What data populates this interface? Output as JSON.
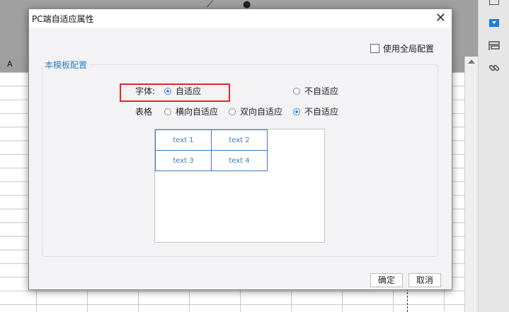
{
  "spreadsheet": {
    "column_a": "A"
  },
  "dialog": {
    "title": "PC端自适应属性",
    "close_glyph": "✕",
    "global_config_label": "使用全局配置",
    "section_title": "本模板配置",
    "font_row": {
      "label": "字体:",
      "options": [
        {
          "label": "自适应",
          "selected": true
        },
        {
          "label": "不自适应",
          "selected": false
        }
      ]
    },
    "table_row": {
      "label": "表格",
      "options": [
        {
          "label": "横向自适应",
          "selected": false
        },
        {
          "label": "双向自适应",
          "selected": false
        },
        {
          "label": "不自适应",
          "selected": true
        }
      ]
    },
    "preview_cells": [
      "text 1",
      "text 2",
      "text 3",
      "text 4"
    ],
    "ok_label": "确定",
    "cancel_label": "取消"
  },
  "colors": {
    "accent": "#3b82d6",
    "highlight_border": "#e02828",
    "section_title": "#2e7fc1"
  },
  "icons": {
    "right_panel": [
      "crop-icon",
      "dropdown-widget-icon",
      "form-icon",
      "link-icon"
    ]
  }
}
